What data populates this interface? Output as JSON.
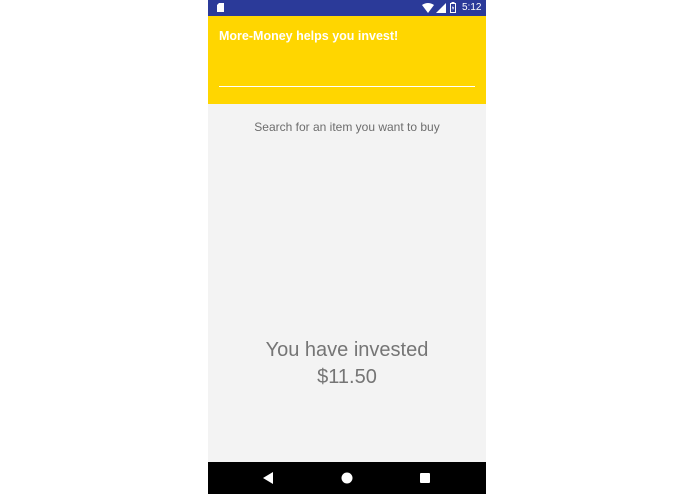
{
  "status_bar": {
    "time": "5:12",
    "icons": [
      "sd-card-icon",
      "wifi-icon",
      "cell-signal-icon",
      "battery-icon"
    ]
  },
  "header": {
    "title": "More-Money helps you invest!",
    "search_value": "",
    "background_color": "#ffd600"
  },
  "main": {
    "hint": "Search for an item you want to buy",
    "invested_label": "You have invested",
    "invested_amount": "$11.50"
  },
  "nav_bar": {
    "buttons": [
      "back-icon",
      "home-icon",
      "recents-icon"
    ]
  },
  "colors": {
    "status_bar": "#2b3a99",
    "accent": "#ffd600",
    "background": "#f3f3f3",
    "text": "#757575"
  }
}
